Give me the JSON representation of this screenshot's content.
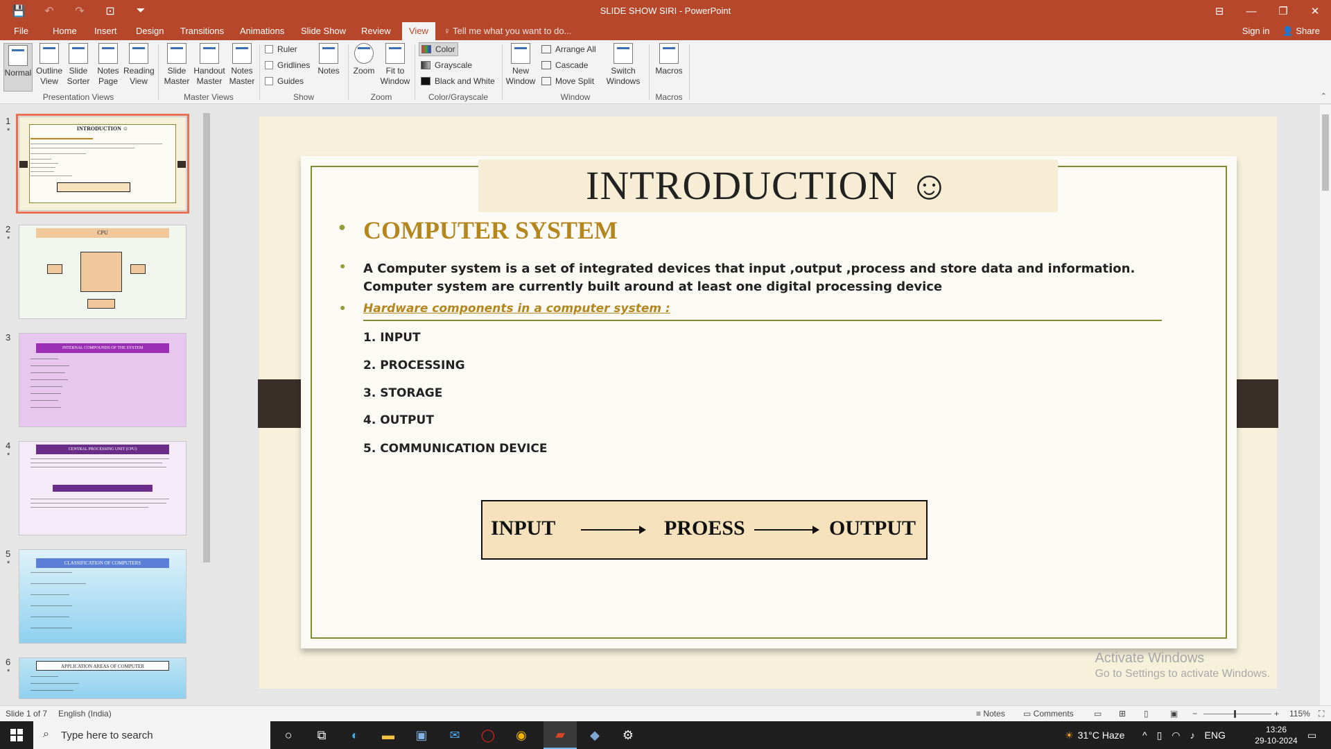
{
  "window": {
    "title": "SLIDE SHOW SIRI - PowerPoint"
  },
  "qat": {
    "save": "💾",
    "undo": "↶",
    "redo": "↷",
    "present": "⊡",
    "more": "⏷"
  },
  "win_controls": {
    "ribbon_options": "⊟",
    "minimize": "—",
    "restore": "❐",
    "close": "✕"
  },
  "menu": {
    "tabs": [
      "File",
      "Home",
      "Insert",
      "Design",
      "Transitions",
      "Animations",
      "Slide Show",
      "Review",
      "View"
    ],
    "active": "View",
    "tell_me": "Tell me what you want to do...",
    "sign_in": "Sign in",
    "share": "Share"
  },
  "ribbon": {
    "presentation_views": {
      "label": "Presentation Views",
      "buttons": [
        "Normal",
        "Outline View",
        "Slide Sorter",
        "Notes Page",
        "Reading View"
      ]
    },
    "master_views": {
      "label": "Master Views",
      "buttons": [
        "Slide Master",
        "Handout Master",
        "Notes Master"
      ]
    },
    "show": {
      "label": "Show",
      "checkboxes": [
        "Ruler",
        "Gridlines",
        "Guides"
      ],
      "notes": "Notes"
    },
    "zoom": {
      "label": "Zoom",
      "buttons": [
        "Zoom",
        "Fit to Window"
      ]
    },
    "color": {
      "label": "Color/Grayscale",
      "options": [
        "Color",
        "Grayscale",
        "Black and White"
      ]
    },
    "window": {
      "label": "Window",
      "new_window": "New Window",
      "small": [
        "Arrange All",
        "Cascade",
        "Move Split"
      ],
      "switch": "Switch Windows"
    },
    "macros": {
      "label": "Macros",
      "button": "Macros"
    }
  },
  "thumbnails": [
    {
      "num": "1",
      "star": "*",
      "title": "INTRODUCTION ☺",
      "bg": "#fbfaf5"
    },
    {
      "num": "2",
      "star": "*",
      "title": "CPU",
      "bg": "#f1f6ee"
    },
    {
      "num": "3",
      "star": "*",
      "title": "INTERNAL COMPOUNDS OF THE SYSTEM",
      "bg": "#e7c7ee"
    },
    {
      "num": "4",
      "star": "*",
      "title": "CENTRAL PROCESSING UNIT (CPU)",
      "bg": "#f5eaf8"
    },
    {
      "num": "5",
      "star": "*",
      "title": "CLASSIFICATION OF COMPUTERS",
      "bg": "#bfe4f3"
    },
    {
      "num": "6",
      "star": "*",
      "title": "APPLICATION AREAS OF COMPUTER",
      "bg": "#a9dbef"
    }
  ],
  "slide": {
    "title": "INTRODUCTION ☺",
    "heading": "COMPUTER SYSTEM",
    "description": "A Computer system is a set of integrated devices that input ,output ,process and store data and information. Computer system are currently built around at least one digital processing device",
    "hardware_heading": "Hardware components in a computer system :",
    "items": [
      "1. INPUT",
      "2. PROCESSING",
      "3. STORAGE",
      "4. OUTPUT",
      "5. COMMUNICATION DEVICE"
    ],
    "flow": {
      "input": "INPUT",
      "process": "PROESS",
      "output": "OUTPUT"
    }
  },
  "watermark": {
    "line1": "Activate Windows",
    "line2": "Go to Settings to activate Windows."
  },
  "status": {
    "slide": "Slide 1 of 7",
    "language": "English (India)",
    "notes": "Notes",
    "comments": "Comments",
    "zoom": "115%"
  },
  "taskbar": {
    "search_placeholder": "Type here to search",
    "weather": "31°C Haze",
    "lang": "ENG",
    "time": "13:26",
    "date": "29-10-2024"
  },
  "colors": {
    "accent": "#b7472a",
    "slide_green": "#7c8c2e",
    "heading_gold": "#b4861e"
  }
}
